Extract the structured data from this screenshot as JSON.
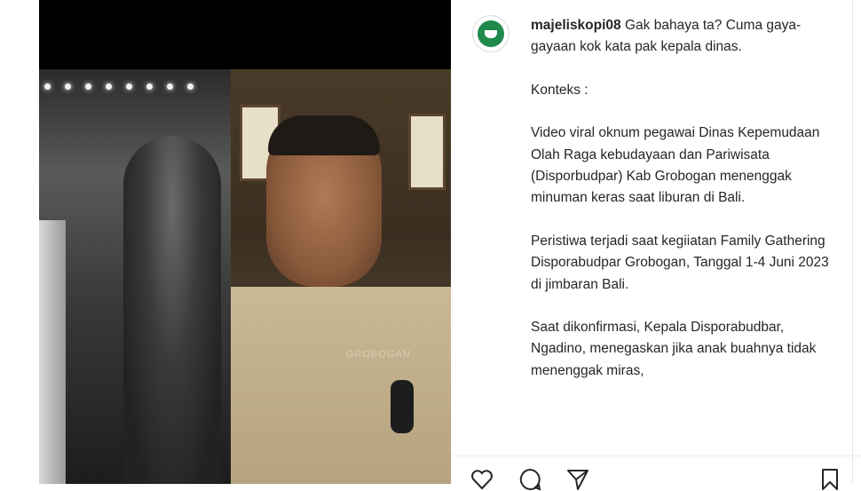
{
  "post": {
    "username": "majeliskopi08",
    "caption_first": "Gak bahaya ta? Cuma gaya-gayaan kok kata pak kepala dinas.",
    "paragraphs": [
      "Konteks :",
      "Video viral oknum pegawai Dinas Kepemudaan Olah Raga kebudayaan dan Pariwisata (Disporbudpar) Kab Grobogan menenggak minuman keras saat liburan di Bali.",
      "Peristiwa terjadi saat kegiiatan Family Gathering Disporabudpar Grobogan, Tanggal 1-4 Juni 2023 di jimbaran Bali.",
      "Saat dikonfirmasi, Kepala Disporabudbar, Ngadino, menegaskan jika anak buahnya tidak menenggak miras,"
    ]
  },
  "media": {
    "watermark": "GROBOGAN"
  },
  "colors": {
    "text": "#262626",
    "avatar_bg": "#1f8a4c"
  },
  "icons": [
    "heart-icon",
    "comment-icon",
    "share-icon",
    "bookmark-icon"
  ]
}
